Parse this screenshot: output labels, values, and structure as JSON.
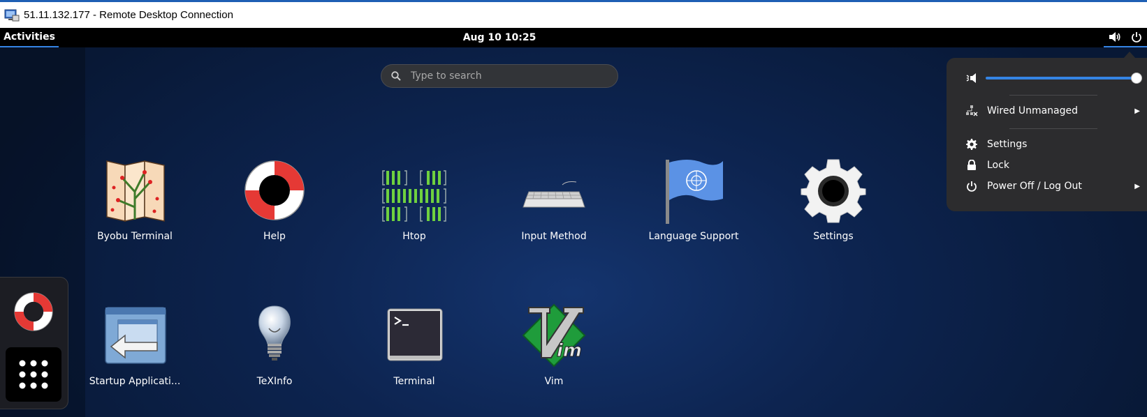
{
  "window": {
    "title": "51.11.132.177 - Remote Desktop Connection"
  },
  "topbar": {
    "activities": "Activities",
    "clock": "Aug 10  10:25"
  },
  "search": {
    "placeholder": "Type to search"
  },
  "apps": [
    {
      "label": "Byobu Terminal",
      "icon": "byobu-map-icon"
    },
    {
      "label": "Help",
      "icon": "lifebuoy-icon"
    },
    {
      "label": "Htop",
      "icon": "htop-icon"
    },
    {
      "label": "Input Method",
      "icon": "keyboard-icon"
    },
    {
      "label": "Language Support",
      "icon": "un-flag-icon"
    },
    {
      "label": "Settings",
      "icon": "gear-icon"
    },
    {
      "label": "Startup Applicati...",
      "icon": "startup-icon"
    },
    {
      "label": "TeXInfo",
      "icon": "lightbulb-icon"
    },
    {
      "label": "Terminal",
      "icon": "terminal-icon"
    },
    {
      "label": "Vim",
      "icon": "vim-icon"
    }
  ],
  "system_menu": {
    "volume_level": 1.0,
    "network": "Wired Unmanaged",
    "settings": "Settings",
    "lock": "Lock",
    "power": "Power Off / Log Out"
  },
  "colors": {
    "accent": "#3584e4",
    "topbar": "#000000",
    "menu_bg": "#2c2c2e"
  }
}
